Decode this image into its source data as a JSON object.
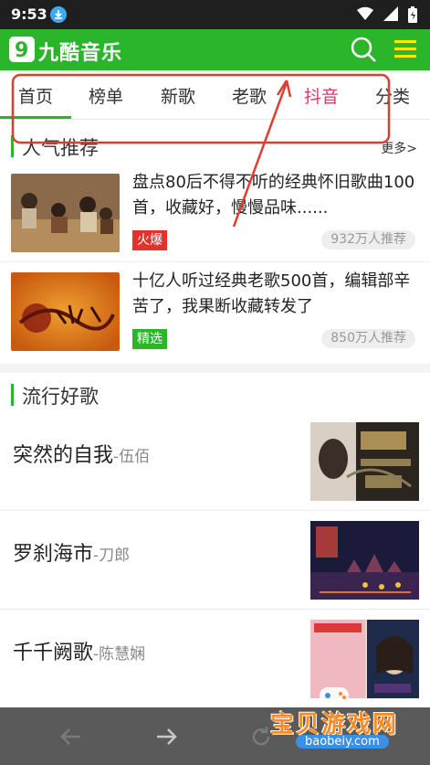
{
  "status_bar": {
    "time": "9:53"
  },
  "app": {
    "title": "九酷音乐"
  },
  "tabs": [
    {
      "label": "首页",
      "active": true
    },
    {
      "label": "榜单"
    },
    {
      "label": "新歌"
    },
    {
      "label": "老歌"
    },
    {
      "label": "抖音",
      "highlight": true
    },
    {
      "label": "分类"
    }
  ],
  "recommend": {
    "title": "人气推荐",
    "more": "更多>",
    "items": [
      {
        "title": "盘点80后不得不听的经典怀旧歌曲100首，收藏好，慢慢品味......",
        "badge": "火爆",
        "count": "932万人推荐"
      },
      {
        "title": "十亿人听过经典老歌500首，编辑部辛苦了，我果断收藏转发了",
        "badge": "精选",
        "count": "850万人推荐"
      }
    ]
  },
  "popular": {
    "title": "流行好歌",
    "songs": [
      {
        "title": "突然的自我",
        "artist": "-伍佰"
      },
      {
        "title": "罗刹海市",
        "artist": "-刀郎"
      },
      {
        "title": "千千阙歌",
        "artist": "-陈慧娴"
      }
    ]
  },
  "watermark": {
    "text": "宝贝游戏网",
    "url": "baobeiy.com"
  },
  "colors": {
    "brand_green": "#2bb52b",
    "accent_pink": "#e8336d",
    "badge_red": "#e3322e",
    "annotation_red": "#e03c2f"
  }
}
